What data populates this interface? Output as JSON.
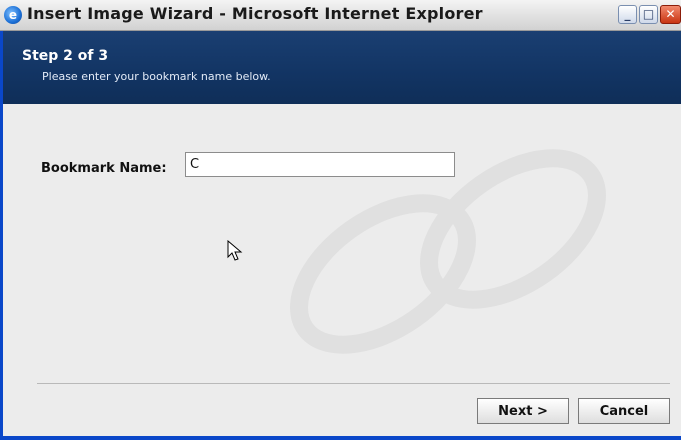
{
  "window": {
    "title": "Insert Image Wizard - Microsoft Internet Explorer",
    "icon": "ie-icon",
    "controls": {
      "minimize": "_",
      "maximize": "□",
      "close": "✕"
    }
  },
  "header": {
    "step": "Step 2 of 3",
    "instruction": "Please enter your bookmark name below."
  },
  "form": {
    "bookmark_label": "Bookmark Name:",
    "bookmark_value": "C"
  },
  "buttons": {
    "next": "Next >",
    "cancel": "Cancel"
  },
  "colors": {
    "header_bg": "#123463",
    "window_border": "#0a47c9",
    "content_bg": "#ececec"
  }
}
